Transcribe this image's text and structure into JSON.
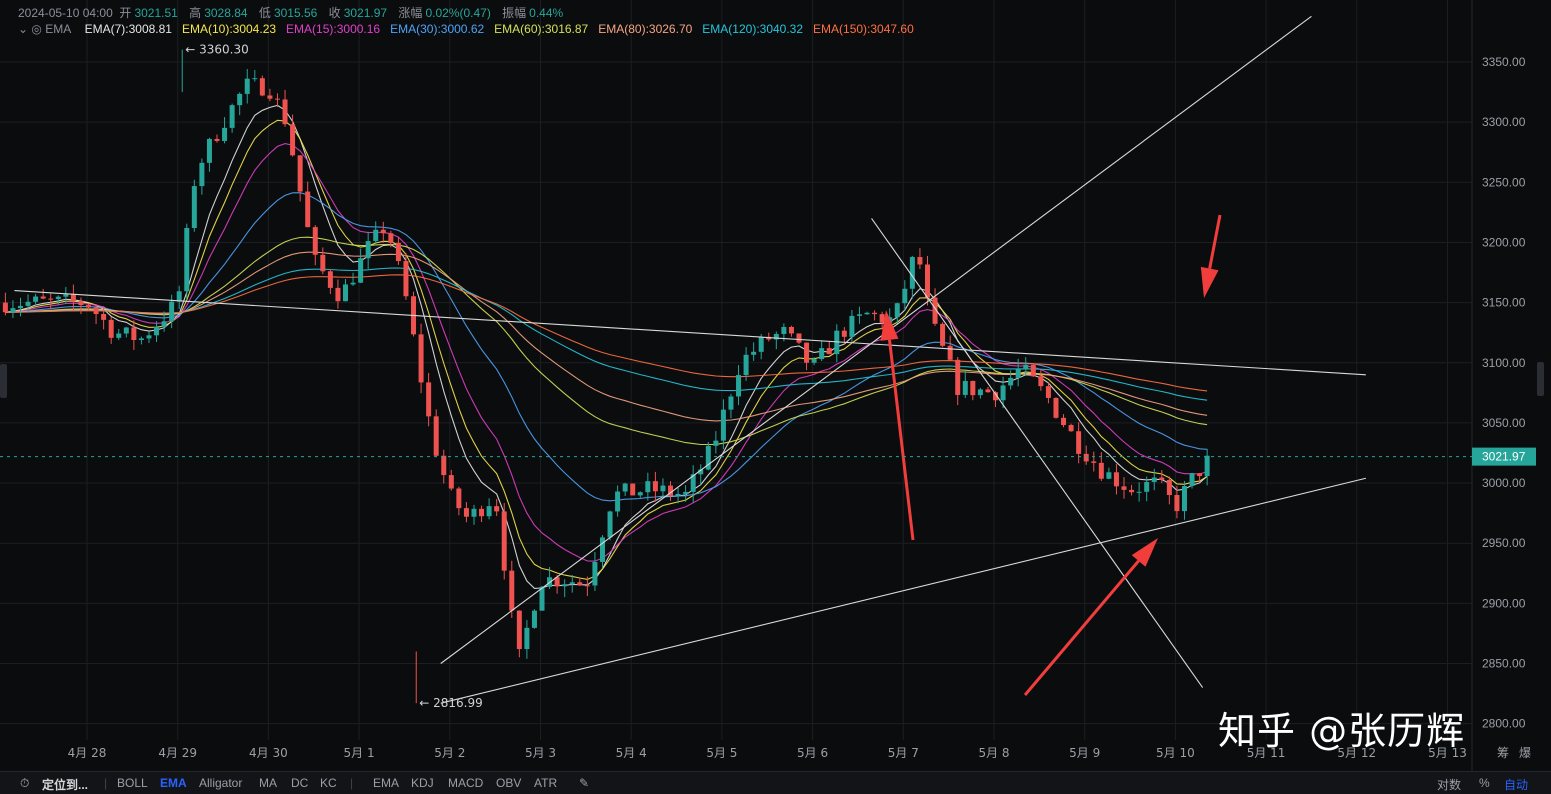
{
  "header": {
    "datetime": "2024-05-10 04:00",
    "open_label": "开",
    "open": "3021.51",
    "high_label": "高",
    "high": "3028.84",
    "low_label": "低",
    "low": "3015.56",
    "close_label": "收",
    "close": "3021.97",
    "change_label": "涨幅",
    "change": "0.02%(0.47)",
    "amplitude_label": "振幅",
    "amplitude": "0.44%"
  },
  "indicator": {
    "name": "EMA",
    "items": [
      {
        "label": "EMA(7):3008.81",
        "color": "#e6e6e6"
      },
      {
        "label": "EMA(10):3004.23",
        "color": "#f5e74b"
      },
      {
        "label": "EMA(15):3000.16",
        "color": "#e040c8"
      },
      {
        "label": "EMA(30):3000.62",
        "color": "#4fa3f7"
      },
      {
        "label": "EMA(60):3016.87",
        "color": "#d4e157"
      },
      {
        "label": "EMA(80):3026.70",
        "color": "#f4a582"
      },
      {
        "label": "EMA(120):3040.32",
        "color": "#26c6da"
      },
      {
        "label": "EMA(150):3047.60",
        "color": "#ff7043"
      }
    ]
  },
  "price_marker": {
    "label": "3021.97",
    "color": "#26a69a"
  },
  "annotations": {
    "high_label": "← 3360.30",
    "low_label": "← 2816.99"
  },
  "chart_data": {
    "type": "candlestick",
    "ylim": [
      2800,
      3390
    ],
    "y_ticks": [
      "3350.00",
      "3300.00",
      "3250.00",
      "3200.00",
      "3150.00",
      "3100.00",
      "3050.00",
      "3000.00",
      "2950.00",
      "2900.00",
      "2850.00",
      "2800.00"
    ],
    "x_ticks": [
      "4月 28",
      "4月 29",
      "4月 30",
      "5月 1",
      "5月 2",
      "5月 3",
      "5月 4",
      "5月 5",
      "5月 6",
      "5月 7",
      "5月 8",
      "5月 9",
      "5月 10",
      "5月 11",
      "5月 12",
      "5月 13"
    ],
    "x_axis_unit_labels": [
      "筹",
      "爆"
    ],
    "last_price": 3021.97,
    "high": 3360.3,
    "low": 2816.99,
    "price_path": [
      {
        "d": 0.0,
        "p": 3150
      },
      {
        "d": 0.3,
        "p": 3125
      },
      {
        "d": 0.6,
        "p": 3120
      },
      {
        "d": 1.0,
        "p": 3150
      },
      {
        "d": 1.2,
        "p": 3260
      },
      {
        "d": 1.5,
        "p": 3300
      },
      {
        "d": 1.75,
        "p": 3330
      },
      {
        "d": 2.0,
        "p": 3330
      },
      {
        "d": 2.2,
        "p": 3300
      },
      {
        "d": 2.5,
        "p": 3185
      },
      {
        "d": 2.8,
        "p": 3155
      },
      {
        "d": 3.1,
        "p": 3195
      },
      {
        "d": 3.3,
        "p": 3215
      },
      {
        "d": 3.5,
        "p": 3160
      },
      {
        "d": 3.8,
        "p": 3040
      },
      {
        "d": 4.0,
        "p": 2990
      },
      {
        "d": 4.2,
        "p": 2970
      },
      {
        "d": 4.5,
        "p": 2990
      },
      {
        "d": 4.75,
        "p": 2850
      },
      {
        "d": 5.0,
        "p": 2920
      },
      {
        "d": 5.3,
        "p": 2920
      },
      {
        "d": 5.5,
        "p": 2915
      },
      {
        "d": 5.8,
        "p": 2990
      },
      {
        "d": 6.2,
        "p": 2995
      },
      {
        "d": 6.6,
        "p": 2990
      },
      {
        "d": 6.9,
        "p": 3030
      },
      {
        "d": 7.2,
        "p": 3100
      },
      {
        "d": 7.5,
        "p": 3120
      },
      {
        "d": 7.7,
        "p": 3125
      },
      {
        "d": 8.0,
        "p": 3095
      },
      {
        "d": 8.3,
        "p": 3125
      },
      {
        "d": 8.6,
        "p": 3140
      },
      {
        "d": 8.9,
        "p": 3135
      },
      {
        "d": 9.15,
        "p": 3195
      },
      {
        "d": 9.3,
        "p": 3135
      },
      {
        "d": 9.6,
        "p": 3080
      },
      {
        "d": 10.0,
        "p": 3075
      },
      {
        "d": 10.3,
        "p": 3095
      },
      {
        "d": 10.6,
        "p": 3070
      },
      {
        "d": 10.9,
        "p": 3035
      },
      {
        "d": 11.2,
        "p": 3010
      },
      {
        "d": 11.5,
        "p": 2995
      },
      {
        "d": 11.8,
        "p": 3000
      },
      {
        "d": 12.0,
        "p": 2980
      },
      {
        "d": 12.2,
        "p": 3005
      },
      {
        "d": 12.4,
        "p": 3021.97
      }
    ],
    "trendlines": [
      {
        "from": {
          "d": -0.8,
          "p": 3160
        },
        "to": {
          "d": 14.1,
          "p": 3090
        }
      },
      {
        "from": {
          "d": 3.9,
          "p": 2850
        },
        "to": {
          "d": 13.5,
          "p": 3388
        }
      },
      {
        "from": {
          "d": 3.9,
          "p": 2817
        },
        "to": {
          "d": 14.1,
          "p": 3004
        }
      },
      {
        "from": {
          "d": 8.65,
          "p": 3220
        },
        "to": {
          "d": 12.3,
          "p": 2830
        }
      }
    ]
  },
  "toolbar": {
    "locate": "定位到...",
    "main_indicators": [
      "BOLL",
      "EMA",
      "Alligator",
      "MA",
      "DC",
      "KC"
    ],
    "sub_indicators": [
      "EMA",
      "KDJ",
      "MACD",
      "OBV",
      "ATR"
    ],
    "right": [
      "对数",
      "%",
      "自动"
    ]
  },
  "watermark": "知乎 @张历辉"
}
